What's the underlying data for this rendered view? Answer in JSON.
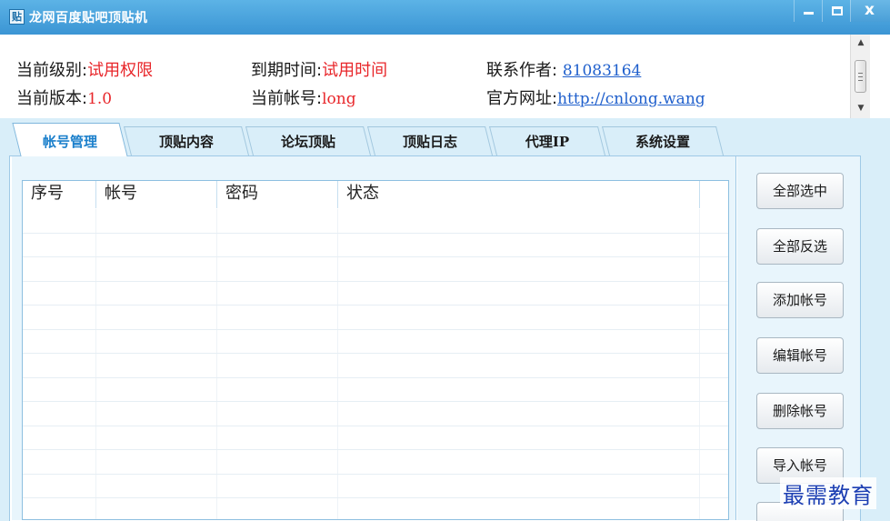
{
  "window": {
    "title": "龙网百度贴吧顶贴机",
    "icon_label": "贴",
    "buttons": [
      "minimize",
      "maximize",
      "close"
    ],
    "close_glyph": "x"
  },
  "info": {
    "level_label": "当前级别:",
    "level_value": "试用权限",
    "expire_label": "到期时间:",
    "expire_value": "试用时间",
    "contact_label": "联系作者:",
    "contact_value": "81083164",
    "version_label": "当前版本:",
    "version_value": "1.0",
    "account_label": "当前帐号:",
    "account_value": "long",
    "website_label": "官方网址:",
    "website_value": "http://cnlong.wang"
  },
  "tabs": [
    {
      "label": "帐号管理",
      "active": true
    },
    {
      "label": "顶贴内容",
      "active": false
    },
    {
      "label": "论坛顶贴",
      "active": false
    },
    {
      "label": "顶贴日志",
      "active": false
    },
    {
      "label": "代理IP",
      "active": false
    },
    {
      "label": "系统设置",
      "active": false
    }
  ],
  "table": {
    "columns": [
      "序号",
      "帐号",
      "密码",
      "状态",
      ""
    ],
    "rows": []
  },
  "side_buttons": [
    "全部选中",
    "全部反选",
    "添加帐号",
    "编辑帐号",
    "删除帐号",
    "导入帐号",
    ""
  ],
  "watermark": "最需教育",
  "colors": {
    "title_bar": "#3b95d4",
    "value_red": "#e8262a",
    "link_blue": "#1f5fcc",
    "active_tab": "#1a7fcb",
    "panel_bg": "#d9eef9"
  }
}
